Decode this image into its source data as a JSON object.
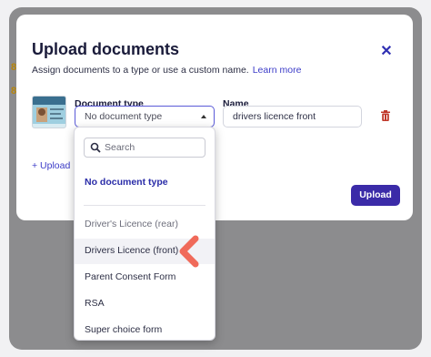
{
  "modal": {
    "title": "Upload documents",
    "subtitle": "Assign documents to a type or use a custom name.",
    "learn_more": "Learn more",
    "close_icon": "close-icon"
  },
  "row": {
    "doc_type_label": "Document type",
    "doc_type_value": "No document type",
    "name_label": "Name",
    "name_value": "drivers licence front",
    "delete_icon": "trash-icon"
  },
  "upload_link": "+ Upload",
  "upload_button": "Upload",
  "dropdown": {
    "search_placeholder": "Search",
    "options": [
      "No document type",
      "Driver's Licence (rear)",
      "Drivers Licence (front)",
      "Parent Consent Form",
      "RSA",
      "Super choice form"
    ]
  },
  "colors": {
    "accent": "#3b2ba8",
    "link": "#3c3cc8",
    "delete": "#c0392b",
    "pointer": "#f06a5a"
  }
}
